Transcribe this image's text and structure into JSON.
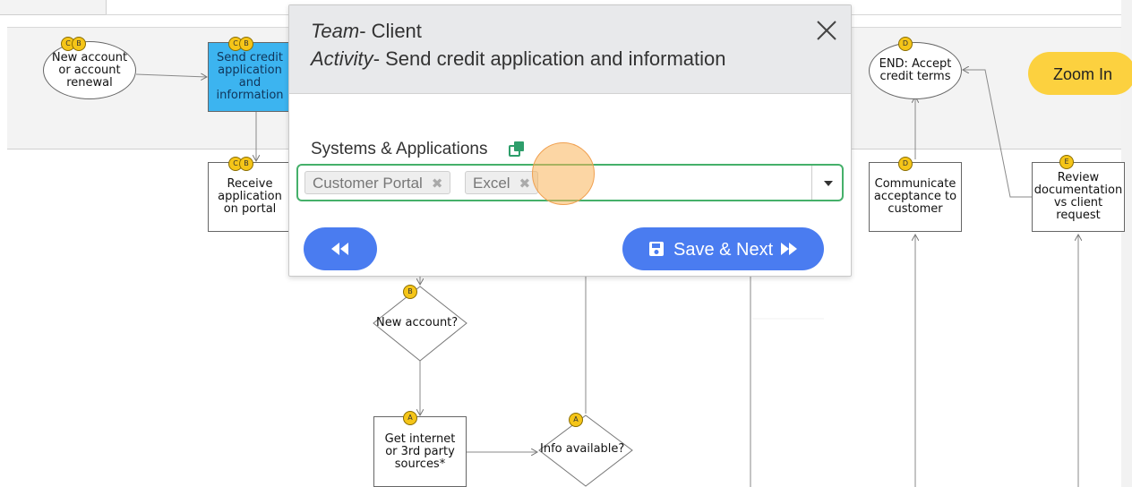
{
  "zoom_button": {
    "label": "Zoom In"
  },
  "nodes": {
    "new_account": {
      "text": "New account or account renewal",
      "badges": [
        "C",
        "B"
      ]
    },
    "send_credit": {
      "text": "Send credit application and information",
      "badges": [
        "C",
        "B"
      ]
    },
    "receive_app": {
      "text": "Receive application on portal",
      "badges": [
        "C",
        "B"
      ]
    },
    "end_accept": {
      "text": "END: Accept credit terms",
      "badges": [
        "D"
      ]
    },
    "communicate": {
      "text": "Communicate acceptance to customer",
      "badges": [
        "D"
      ]
    },
    "review_doc": {
      "text": "Review documentation vs client request",
      "badges": [
        "E"
      ]
    },
    "new_account_q": {
      "text": "New account?",
      "badges": [
        "B"
      ]
    },
    "get_internet": {
      "text": "Get internet or 3rd party sources*",
      "badges": [
        "A"
      ]
    },
    "info_available": {
      "text": "Info available?",
      "badges": [
        "A"
      ]
    }
  },
  "modal": {
    "team_label": "Team",
    "team_value": "- Client",
    "activity_label": "Activity",
    "activity_value": "- Send credit application and information",
    "systems_label": "Systems & Applications",
    "chips": [
      "Customer Portal",
      "Excel"
    ],
    "save_label": "Save & Next"
  },
  "colors": {
    "accent_blue": "#4a7cf0",
    "node_blue": "#3cb4f0",
    "badge_yellow": "#f5c518",
    "zoom_yellow": "#fcd13f",
    "select_border": "#45b06a"
  },
  "icons": {
    "close": "close-icon",
    "copy": "copy-icon",
    "back": "rewind-icon",
    "save": "floppy-disk-icon",
    "forward": "fast-forward-icon"
  }
}
